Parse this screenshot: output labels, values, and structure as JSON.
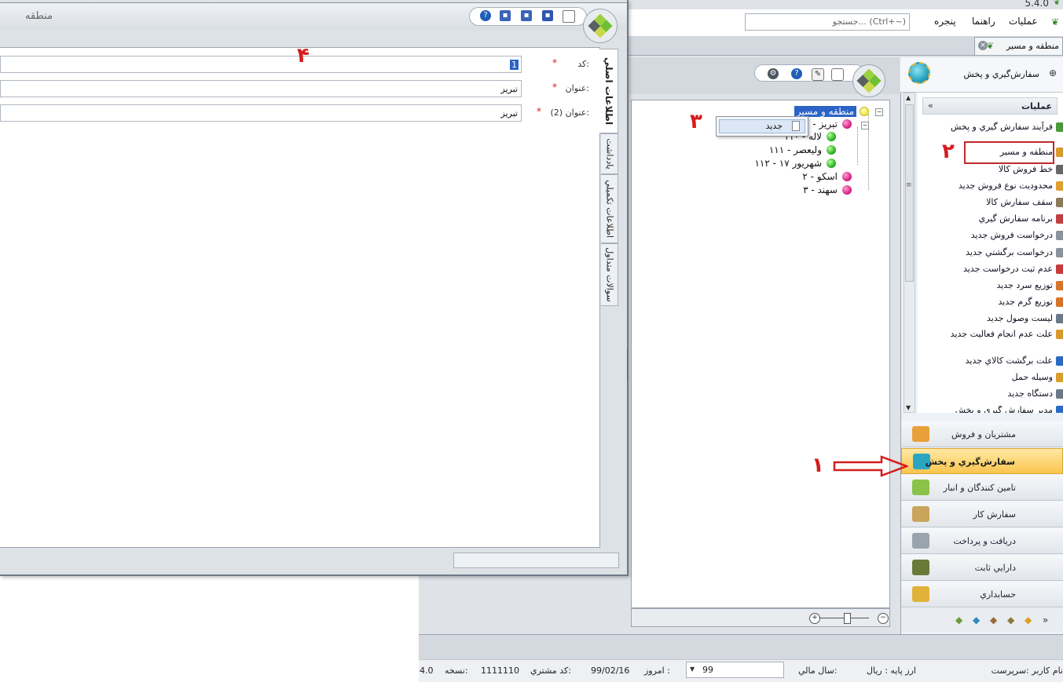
{
  "app": {
    "version": "5.4.0",
    "menu": [
      "عملیات",
      "راهنما",
      "پنجره"
    ],
    "search_placeholder": "جستجو... (Ctrl+~)",
    "open_tab": "منطقه و مسیر"
  },
  "nav": {
    "header_title": "سفارش‌گیري و پخش",
    "group_title": "عملیات",
    "items": [
      {
        "label": "فرآیند سفارش گیري و پخش",
        "icon": "people-icon"
      },
      {
        "label": "منطقه و مسیر",
        "icon": "region-icon"
      },
      {
        "label": "خط فروش کالا",
        "icon": "barcode-icon"
      },
      {
        "label": "محدودیت نوع فروش جدید",
        "icon": "tag-icon"
      },
      {
        "label": "سقف سفارش کالا",
        "icon": "stack-icon"
      },
      {
        "label": "برنامه سفارش گیري",
        "icon": "calendar-icon"
      },
      {
        "label": "درخواست فروش جدید",
        "icon": "document-icon"
      },
      {
        "label": "درخواست برگشتي جدید",
        "icon": "document-icon"
      },
      {
        "label": "عدم ثبت درخواست جدید",
        "icon": "warning-icon"
      },
      {
        "label": "توزیع سرد جدید",
        "icon": "truck-icon"
      },
      {
        "label": "توزیع گرم جدید",
        "icon": "truck-icon"
      },
      {
        "label": "لیست وصول جدید",
        "icon": "list-icon"
      },
      {
        "label": "علت عدم انجام فعالیت جدید",
        "icon": "clipboard-icon"
      },
      {
        "label": "علت برگشت کالاي جدید",
        "icon": "cart-icon"
      },
      {
        "label": "وسیله حمل",
        "icon": "vehicle-icon"
      },
      {
        "label": "دستگاه جدید",
        "icon": "device-icon"
      },
      {
        "label": "مدیر سفارش گیري و پخش",
        "icon": "manager-icon"
      }
    ],
    "modules": [
      {
        "label": "مشتریان و فروش",
        "color": "#e8a13a"
      },
      {
        "label": "سفارش‌گیري و پخش",
        "color": "#2aa6c2"
      },
      {
        "label": "تامین کنندگان و انبار",
        "color": "#8bc34a"
      },
      {
        "label": "سفارش کار",
        "color": "#c9a45a"
      },
      {
        "label": "دریافت و پرداخت",
        "color": "#9aa4ae"
      },
      {
        "label": "دارایي ثابت",
        "color": "#6a7a3a"
      },
      {
        "label": "حسابداري",
        "color": "#e0b23a"
      }
    ]
  },
  "tree": {
    "root": "منطقه و مسیر",
    "nodes": [
      {
        "label": "۱ - تبریز",
        "color": "pink"
      },
      {
        "label": "۱۱۰ - لاله",
        "color": "green"
      },
      {
        "label": "۱۱۱ - ولیعصر",
        "color": "green"
      },
      {
        "label": "۱۱۲ - ۱۷ شهریور",
        "color": "green"
      },
      {
        "label": "۲ - اسکو",
        "color": "pink"
      },
      {
        "label": "۳ - سهند",
        "color": "pink"
      }
    ],
    "context_menu": {
      "new_label": "جدید"
    }
  },
  "form": {
    "title": "منطقه",
    "fields": [
      {
        "label": "کد:",
        "value": "1"
      },
      {
        "label": "عنوان:",
        "value": "تبریز"
      },
      {
        "label": "عنوان (2):",
        "value": "تبریز"
      }
    ],
    "tabs": [
      "اطلاعات اصلي",
      "یادداشت",
      "اطلاعات تکمیلي",
      "سوالات متداول"
    ]
  },
  "status": {
    "user": "نام کاربر :سرپرست",
    "currency": "ارز پایه : ریال",
    "fiscal_year_label": "سال مالي:",
    "fiscal_year": "99",
    "today_label": "امروز :",
    "today": "99/02/16",
    "customer_code_label": "کد مشتري:",
    "customer_code": "1111110",
    "version_label": "نسخه:",
    "version": "4.0"
  },
  "annotations": [
    "۱",
    "۲",
    "۳",
    "۴"
  ]
}
